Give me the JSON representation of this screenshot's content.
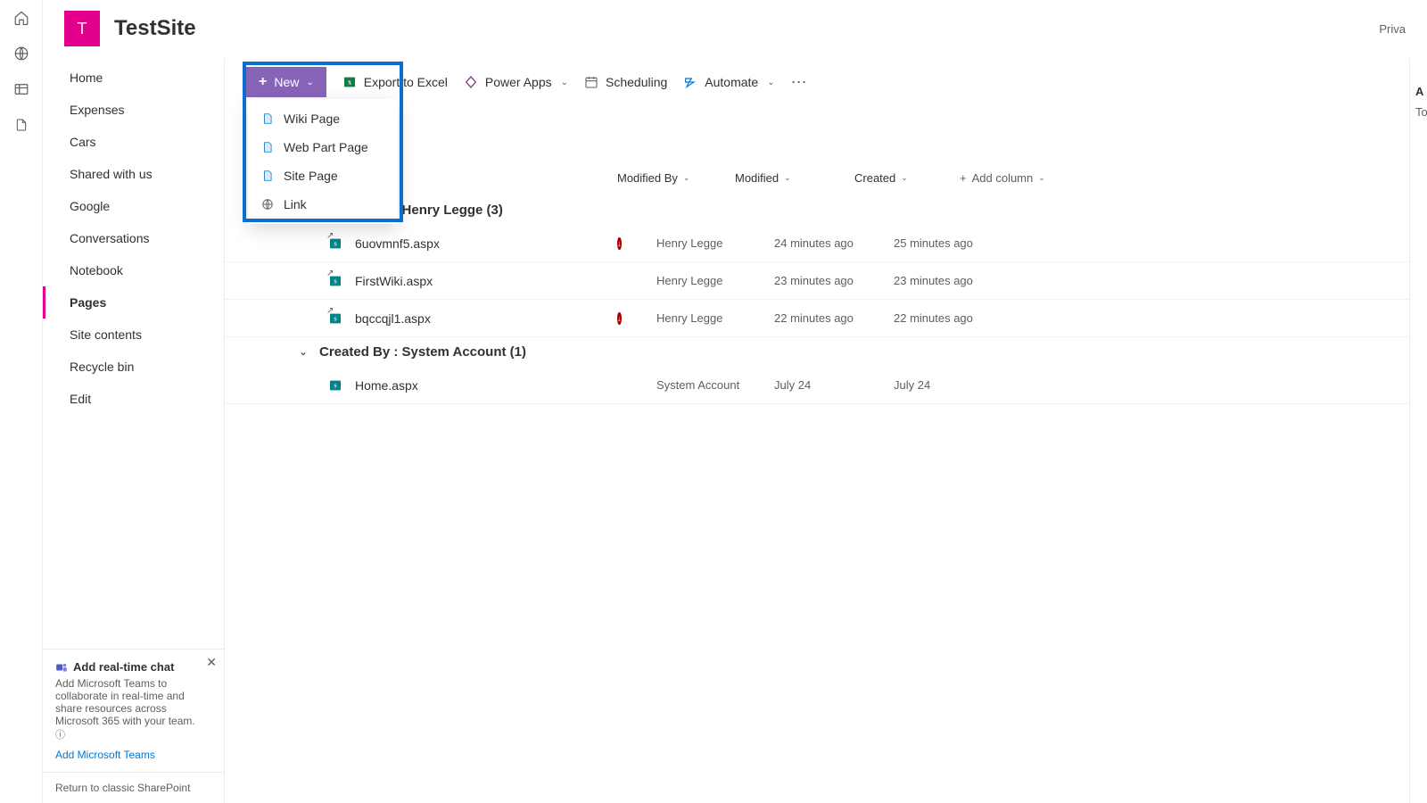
{
  "site": {
    "tile_letter": "T",
    "title": "TestSite",
    "privacy_label": "Priva"
  },
  "rail": {
    "home": "home-icon",
    "globe": "globe-icon",
    "news": "news-icon",
    "file": "file-icon"
  },
  "nav": {
    "items": [
      {
        "label": "Home"
      },
      {
        "label": "Expenses"
      },
      {
        "label": "Cars"
      },
      {
        "label": "Shared with us"
      },
      {
        "label": "Google"
      },
      {
        "label": "Conversations"
      },
      {
        "label": "Notebook"
      },
      {
        "label": "Pages"
      },
      {
        "label": "Site contents"
      },
      {
        "label": "Recycle bin"
      },
      {
        "label": "Edit"
      }
    ],
    "selected_index": 7
  },
  "cmdbar": {
    "new_label": "New",
    "export_label": "Export to Excel",
    "powerapps_label": "Power Apps",
    "scheduling_label": "Scheduling",
    "automate_label": "Automate"
  },
  "new_menu": {
    "items": [
      {
        "label": "Wiki Page"
      },
      {
        "label": "Web Part Page"
      },
      {
        "label": "Site Page"
      },
      {
        "label": "Link"
      }
    ]
  },
  "columns": {
    "modified_by": "Modified By",
    "modified": "Modified",
    "created": "Created",
    "add": "Add column"
  },
  "groups": [
    {
      "header": "Created By : Henry Legge (3)",
      "rows": [
        {
          "name": "6uovmnf5.aspx",
          "modified_by": "Henry Legge",
          "modified": "24 minutes ago",
          "created": "25 minutes ago",
          "has_status": true
        },
        {
          "name": "FirstWiki.aspx",
          "modified_by": "Henry Legge",
          "modified": "23 minutes ago",
          "created": "23 minutes ago",
          "has_status": false
        },
        {
          "name": "bqccqjl1.aspx",
          "modified_by": "Henry Legge",
          "modified": "22 minutes ago",
          "created": "22 minutes ago",
          "has_status": true
        }
      ]
    },
    {
      "header": "Created By : System Account (1)",
      "rows": [
        {
          "name": "Home.aspx",
          "modified_by": "System Account",
          "modified": "July 24",
          "created": "July 24",
          "has_status": false
        }
      ]
    }
  ],
  "chat_card": {
    "title": "Add real-time chat",
    "body": "Add Microsoft Teams to collaborate in real-time and share resources across Microsoft 365 with your team.",
    "link": "Add Microsoft Teams"
  },
  "classic_link": "Return to classic SharePoint",
  "right_pane": {
    "title_initial": "A",
    "sub_initial": "To"
  }
}
